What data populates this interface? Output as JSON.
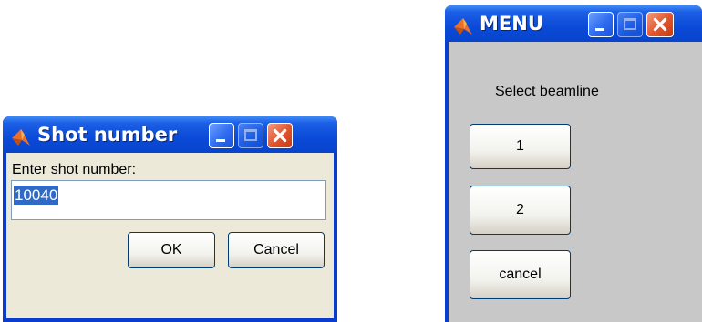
{
  "dialog_shot": {
    "title": "Shot number",
    "prompt": "Enter shot number:",
    "input_value": "10040",
    "ok_label": "OK",
    "cancel_label": "Cancel",
    "icon": "matlab-icon"
  },
  "dialog_menu": {
    "title": "MENU",
    "prompt": "Select beamline",
    "options": [
      "1",
      "2",
      "cancel"
    ],
    "icon": "matlab-icon"
  },
  "colors": {
    "titlebar": "#0a4ad8",
    "client_shot": "#ece9d8",
    "client_menu": "#c8c8c8",
    "selection": "#316ac5",
    "close_button": "#e0532b"
  }
}
